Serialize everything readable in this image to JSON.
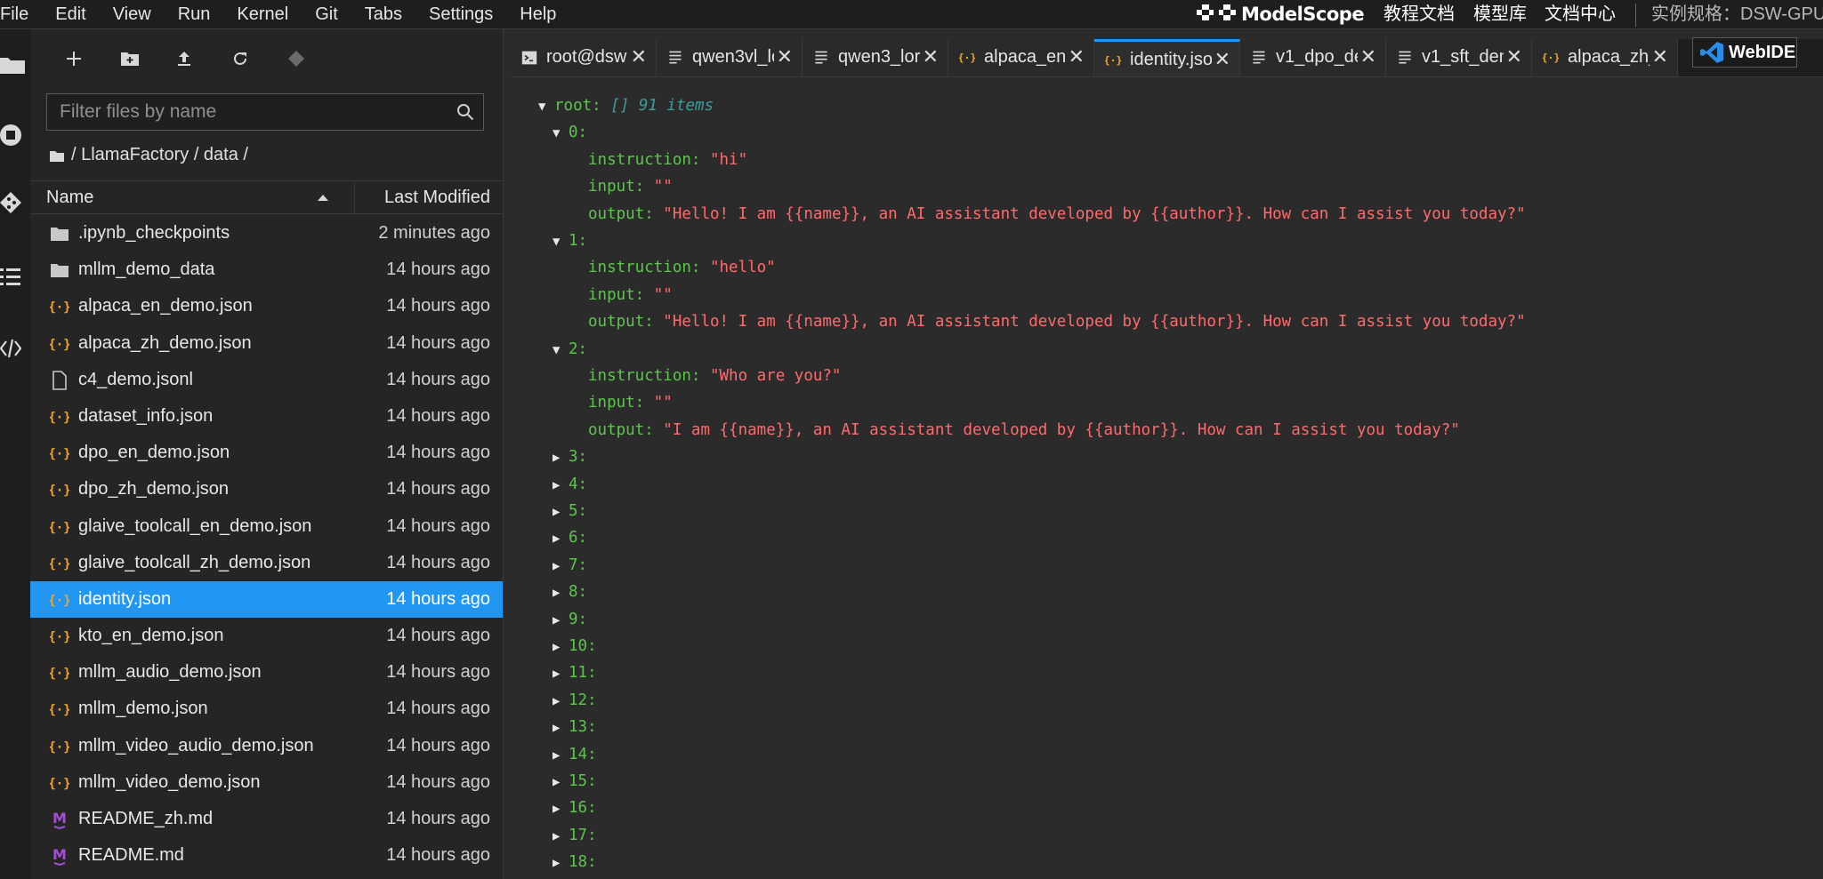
{
  "menubar": {
    "items": [
      "File",
      "Edit",
      "View",
      "Run",
      "Kernel",
      "Git",
      "Tabs",
      "Settings",
      "Help"
    ],
    "brand": "ModelScope",
    "links": [
      "教程文档",
      "模型库",
      "文档中心"
    ],
    "spec": "实例规格：DSW-GPU"
  },
  "filebrowser": {
    "filter_placeholder": "Filter files by name",
    "breadcrumb": "/ LlamaFactory / data /",
    "col_name": "Name",
    "col_modified": "Last Modified",
    "files": [
      {
        "name": ".ipynb_checkpoints",
        "modified": "2 minutes ago",
        "icon": "folder-icon"
      },
      {
        "name": "mllm_demo_data",
        "modified": "14 hours ago",
        "icon": "folder-icon"
      },
      {
        "name": "alpaca_en_demo.json",
        "modified": "14 hours ago",
        "icon": "json-icon"
      },
      {
        "name": "alpaca_zh_demo.json",
        "modified": "14 hours ago",
        "icon": "json-icon"
      },
      {
        "name": "c4_demo.jsonl",
        "modified": "14 hours ago",
        "icon": "file-icon"
      },
      {
        "name": "dataset_info.json",
        "modified": "14 hours ago",
        "icon": "json-icon"
      },
      {
        "name": "dpo_en_demo.json",
        "modified": "14 hours ago",
        "icon": "json-icon"
      },
      {
        "name": "dpo_zh_demo.json",
        "modified": "14 hours ago",
        "icon": "json-icon"
      },
      {
        "name": "glaive_toolcall_en_demo.json",
        "modified": "14 hours ago",
        "icon": "json-icon"
      },
      {
        "name": "glaive_toolcall_zh_demo.json",
        "modified": "14 hours ago",
        "icon": "json-icon"
      },
      {
        "name": "identity.json",
        "modified": "14 hours ago",
        "icon": "json-icon",
        "selected": true
      },
      {
        "name": "kto_en_demo.json",
        "modified": "14 hours ago",
        "icon": "json-icon"
      },
      {
        "name": "mllm_audio_demo.json",
        "modified": "14 hours ago",
        "icon": "json-icon"
      },
      {
        "name": "mllm_demo.json",
        "modified": "14 hours ago",
        "icon": "json-icon"
      },
      {
        "name": "mllm_video_audio_demo.json",
        "modified": "14 hours ago",
        "icon": "json-icon"
      },
      {
        "name": "mllm_video_demo.json",
        "modified": "14 hours ago",
        "icon": "json-icon"
      },
      {
        "name": "README_zh.md",
        "modified": "14 hours ago",
        "icon": "markdown-icon"
      },
      {
        "name": "README.md",
        "modified": "14 hours ago",
        "icon": "markdown-icon"
      }
    ]
  },
  "tabs": [
    {
      "label": "root@dsw",
      "icon": "terminal-icon"
    },
    {
      "label": "qwen3vl_lo",
      "icon": "text-file-icon"
    },
    {
      "label": "qwen3_lor",
      "icon": "text-file-icon"
    },
    {
      "label": "alpaca_en_",
      "icon": "json-icon"
    },
    {
      "label": "identity.jso",
      "icon": "json-icon",
      "active": true
    },
    {
      "label": "v1_dpo_de",
      "icon": "text-file-icon"
    },
    {
      "label": "v1_sft_den",
      "icon": "text-file-icon"
    },
    {
      "label": "alpaca_zh_",
      "icon": "json-icon"
    }
  ],
  "webide_label": "WebIDE",
  "json": {
    "root_key": "root:",
    "root_meta": "[] 91 items",
    "expanded": [
      {
        "index": "0:",
        "instruction": "\"hi\"",
        "input": "\"\"",
        "output": "\"Hello! I am {{name}}, an AI assistant developed by {{author}}. How can I assist you today?\""
      },
      {
        "index": "1:",
        "instruction": "\"hello\"",
        "input": "\"\"",
        "output": "\"Hello! I am {{name}}, an AI assistant developed by {{author}}. How can I assist you today?\""
      },
      {
        "index": "2:",
        "instruction": "\"Who are you?\"",
        "input": "\"\"",
        "output": "\"I am {{name}}, an AI assistant developed by {{author}}. How can I assist you today?\""
      }
    ],
    "field_instruction": "instruction:",
    "field_input": "input:",
    "field_output": "output:",
    "collapsed": [
      "3:",
      "4:",
      "5:",
      "6:",
      "7:",
      "8:",
      "9:",
      "10:",
      "11:",
      "12:",
      "13:",
      "14:",
      "15:",
      "16:",
      "17:",
      "18:"
    ]
  }
}
